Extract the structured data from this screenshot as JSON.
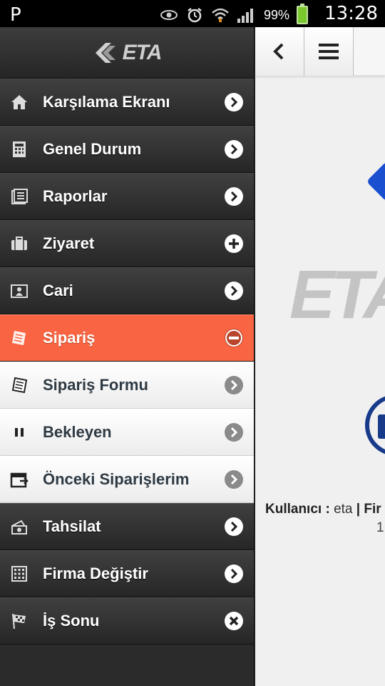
{
  "status_bar": {
    "left_glyph": "P",
    "battery_pct": "99%",
    "time": "13:28",
    "icons": [
      "eye-icon",
      "alarm-icon",
      "wifi-icon",
      "signal-icon",
      "battery-icon"
    ]
  },
  "sidebar": {
    "logo_text": "ETA",
    "items": [
      {
        "label": "Karşılama Ekranı",
        "icon": "home-icon",
        "action": "chevron-right"
      },
      {
        "label": "Genel Durum",
        "icon": "calculator-icon",
        "action": "chevron-right"
      },
      {
        "label": "Raporlar",
        "icon": "report-icon",
        "action": "chevron-right"
      },
      {
        "label": "Ziyaret",
        "icon": "briefcase-icon",
        "action": "plus"
      },
      {
        "label": "Cari",
        "icon": "contact-card-icon",
        "action": "chevron-right"
      },
      {
        "label": "Sipariş",
        "icon": "order-icon",
        "action": "minus",
        "active": true
      },
      {
        "label": "Sipariş Formu",
        "icon": "order-form-icon",
        "action": "chevron-right",
        "sub": true
      },
      {
        "label": "Bekleyen",
        "icon": "pause-icon",
        "action": "chevron-right",
        "sub": true
      },
      {
        "label": "Önceki Siparişlerim",
        "icon": "calendar-icon",
        "action": "chevron-right",
        "sub": true
      },
      {
        "label": "Tahsilat",
        "icon": "cash-icon",
        "action": "chevron-right"
      },
      {
        "label": "Firma Değiştir",
        "icon": "grid-icon",
        "action": "chevron-right"
      },
      {
        "label": "İş Sonu",
        "icon": "checkered-flag-icon",
        "action": "close"
      }
    ]
  },
  "main": {
    "back_icon": "back-icon",
    "menu_icon": "hamburger-icon",
    "brand_watermark": "ETA",
    "user_label": "Kullanıcı :",
    "user_value": "eta",
    "separator": "|",
    "firm_label_partial": "Fir",
    "second_line_partial": "1"
  },
  "colors": {
    "active_item": "#f96543",
    "sidebar_bg": "#2b2b2b",
    "sub_item_bg": "#f4f4f4"
  }
}
